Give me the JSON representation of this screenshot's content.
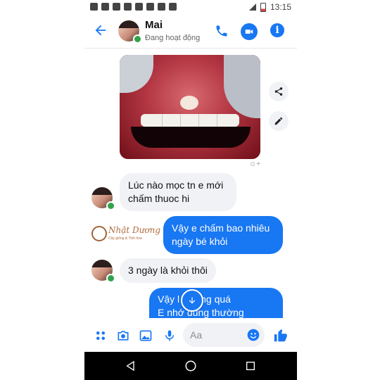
{
  "status_bar": {
    "time": "13:15"
  },
  "header": {
    "contact_name": "Mai",
    "presence": "Đang hoạt động"
  },
  "messages": [
    {
      "sender": "them",
      "text_line1": "Lúc nào mọc tn e mới",
      "text_line2": "chấm thuoc hi"
    },
    {
      "sender": "me",
      "text_line1": "Vậy e chấm bao nhiêu",
      "text_line2": "ngày bé khỏi"
    },
    {
      "sender": "them",
      "text_line1": "3 ngày là khỏi thôi"
    },
    {
      "sender": "me",
      "text_line1_a": "Vậy l",
      "text_line1_b": "ng quá",
      "text_line2": "E nhớ dùng thường"
    }
  ],
  "watermark": {
    "brand": "Nhật Dương",
    "tagline": "Cây giống & Tinh hoa"
  },
  "composer": {
    "placeholder": "Aa"
  },
  "colors": {
    "accent": "#1877f2",
    "online": "#31a24c",
    "bubble_in": "#f0f2f5"
  }
}
